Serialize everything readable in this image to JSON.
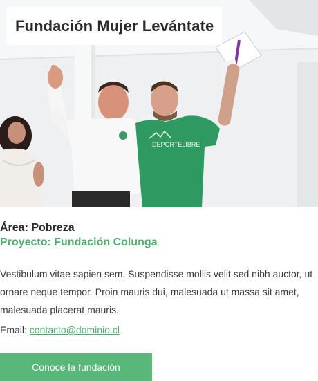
{
  "header": {
    "title": "Fundación Mujer Levántate"
  },
  "photo": {
    "shirt_text": "DEPORTELIBRE"
  },
  "info": {
    "area": "Área: Pobreza",
    "project": "Proyecto: Fundación Colunga"
  },
  "description": "Vestibulum vitae sapien sem. Suspendisse mollis velit sed nibh auctor, ut ornare neque tempor. Proin mauris dui, malesuada ut massa sit amet, malesuada placerat mauris.",
  "contact": {
    "label": "Email: ",
    "email": "contacto@dominio.cl"
  },
  "cta": {
    "label": "Conoce la fundación"
  },
  "colors": {
    "accent": "#4caf6e",
    "button": "#59b77a",
    "shirt": "#2e9a61"
  }
}
